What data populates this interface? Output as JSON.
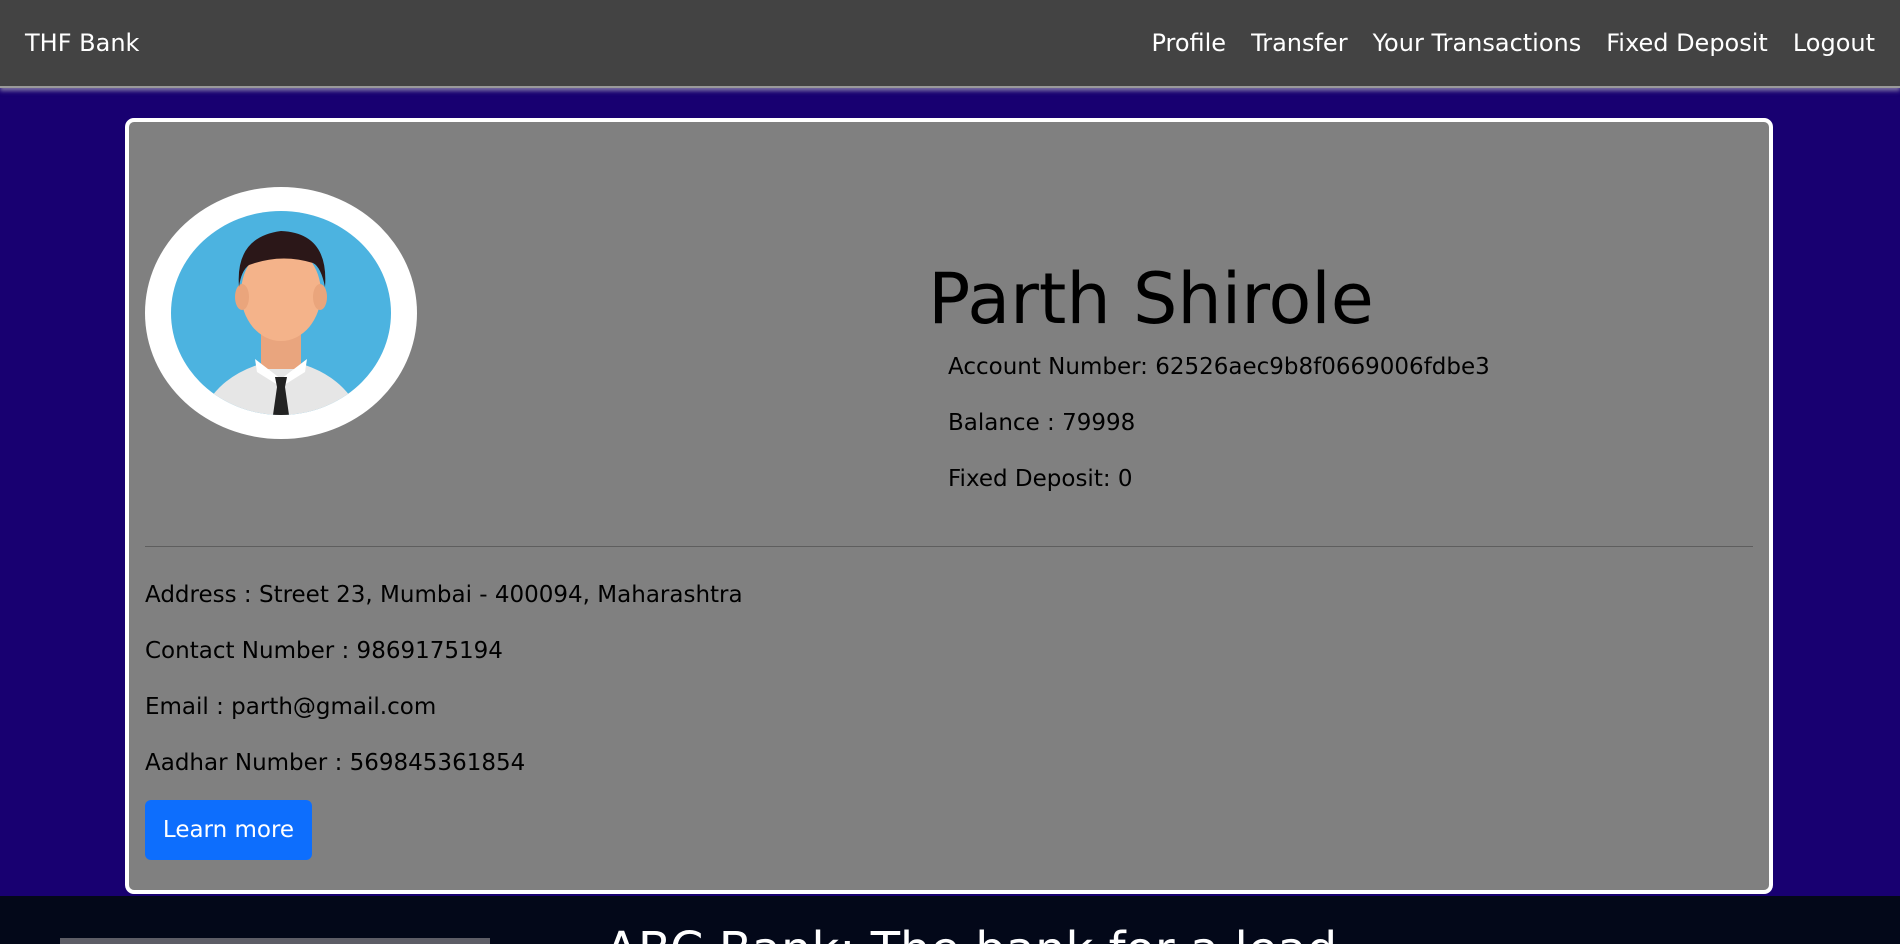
{
  "nav": {
    "brand": "THF Bank",
    "links": [
      "Profile",
      "Transfer",
      "Your Transactions",
      "Fixed Deposit",
      "Logout"
    ]
  },
  "profile": {
    "name": "Parth Shirole",
    "account_number": "Account Number: 62526aec9b8f0669006fdbe3",
    "balance": "Balance : 79998",
    "fixed_deposit": "Fixed Deposit: 0",
    "address": "Address : Street 23, Mumbai - 400094, Maharashtra",
    "contact": "Contact Number : 9869175194",
    "email": "Email : parth@gmail.com",
    "aadhar": "Aadhar Number : 569845361854",
    "button": "Learn more"
  },
  "footer": {
    "title": "ABC Bank: The bank for a lead"
  },
  "colors": {
    "page_bg": "#180071",
    "navbar_bg": "#434343",
    "card_bg": "#808080",
    "button_bg": "#0d6efd",
    "footer_bg": "#030819"
  }
}
